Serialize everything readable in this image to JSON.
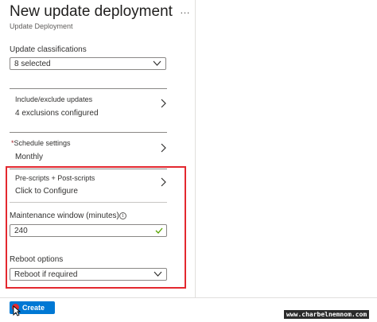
{
  "header": {
    "title": "New update deployment",
    "more_icon": "ellipsis-icon",
    "more_label": "…",
    "subtitle": "Update Deployment"
  },
  "update_classifications": {
    "label": "Update classifications",
    "value": "8 selected"
  },
  "include_exclude": {
    "label": "Include/exclude updates",
    "value": "4 exclusions configured"
  },
  "schedule": {
    "required_marker": "*",
    "label": "Schedule settings",
    "value": "Monthly"
  },
  "scripts": {
    "label": "Pre-scripts + Post-scripts",
    "value": "Click to Configure"
  },
  "maintenance": {
    "label": "Maintenance window (minutes)",
    "info_glyph": "i",
    "value": "240",
    "valid": true
  },
  "reboot": {
    "label": "Reboot options",
    "value": "Reboot if required"
  },
  "footer": {
    "create_label": "Create"
  },
  "watermark": "www.charbelnemnom.com",
  "colors": {
    "accent": "#0078d4",
    "highlight": "#e3282f",
    "valid": "#57a300",
    "required": "#a4262c"
  }
}
